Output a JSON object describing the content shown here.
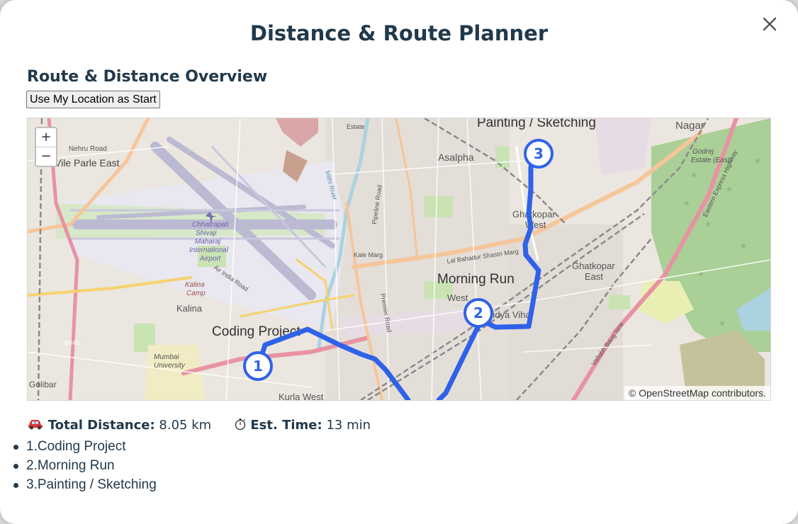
{
  "modal": {
    "title": "Distance & Route Planner",
    "close_icon": "close-icon"
  },
  "route": {
    "section_title": "Route & Distance Overview",
    "use_location_label": "Use My Location as Start"
  },
  "map": {
    "zoom_in": "+",
    "zoom_out": "−",
    "attribution_symbol": "©",
    "attribution_link": "OpenStreetMap",
    "attribution_suffix": "contributors.",
    "route_color": "#2f62e9",
    "place_labels": [
      "Painting / Sketching",
      "Nagar",
      "Asalpha",
      "Vile Parle East",
      "Nehru Road",
      "Chhatrapati",
      "Shivaji",
      "Maharaj",
      "International",
      "Airport",
      "Air India Road",
      "Ghatkopar",
      "West",
      "Ghatkopar",
      "East",
      "Godrej",
      "Estate (East)",
      "Lal Bahadur Shastri Marg",
      "Kale Marg",
      "Morning Run",
      "West",
      "Vidya Vihar",
      "Kalina",
      "Camp",
      "Kalina",
      "Coding Project",
      "Mumbai",
      "University",
      "Golibar",
      "Kurla West",
      "NH48",
      "Estate",
      "Pipeline Road",
      "Eastern Express Highway",
      "Vallabh Baug lane",
      "Premier Road",
      "Mithi River"
    ],
    "markers": [
      {
        "number": "1",
        "name": "Coding Project"
      },
      {
        "number": "2",
        "name": "Morning Run"
      },
      {
        "number": "3",
        "name": "Painting / Sketching"
      }
    ]
  },
  "summary": {
    "distance_icon": "car-icon",
    "distance_label": "Total Distance:",
    "distance_value": "8.05 km",
    "time_icon": "stopwatch-icon",
    "time_label": "Est. Time:",
    "time_value": "13 min"
  },
  "stops": [
    "1.Coding Project",
    "2.Morning Run",
    "3.Painting / Sketching"
  ]
}
